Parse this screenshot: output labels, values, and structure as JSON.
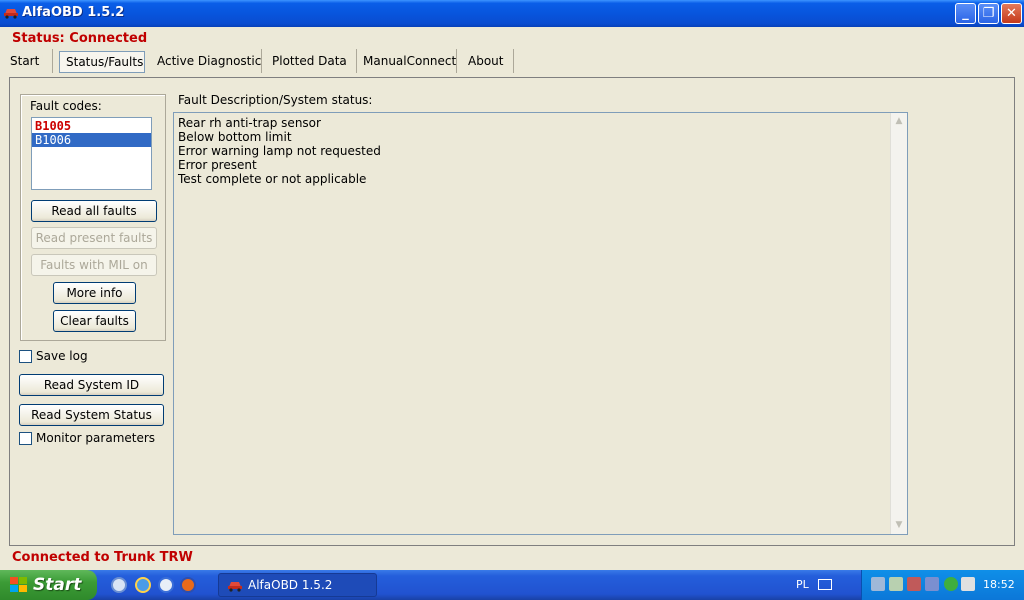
{
  "window": {
    "title": "AlfaOBD 1.5.2"
  },
  "status": "Status: Connected",
  "tabs": [
    "Start",
    "Status/Faults",
    "Active Diagnostic",
    "Plotted Data",
    "ManualConnect",
    "About"
  ],
  "faults": {
    "label": "Fault codes:",
    "codes": [
      "B1005",
      "B1006"
    ],
    "buttons": {
      "read_all": "Read all faults",
      "read_present": "Read present faults",
      "mil_on": "Faults with MIL on",
      "more_info": "More info",
      "clear": "Clear faults"
    }
  },
  "controls": {
    "save_log": "Save log",
    "read_system_id": "Read System ID",
    "read_system_status": "Read System Status",
    "monitor_params": "Monitor parameters"
  },
  "description": {
    "label": "Fault Description/System status:",
    "lines": [
      "Rear rh anti-trap sensor",
      "Below bottom limit",
      "Error warning lamp not requested",
      "Error present",
      "Test complete or not applicable"
    ]
  },
  "footer": "Connected to Trunk TRW",
  "taskbar": {
    "start_label": "Start",
    "app_label": "AlfaOBD 1.5.2",
    "language": "PL",
    "clock": "18:52"
  }
}
